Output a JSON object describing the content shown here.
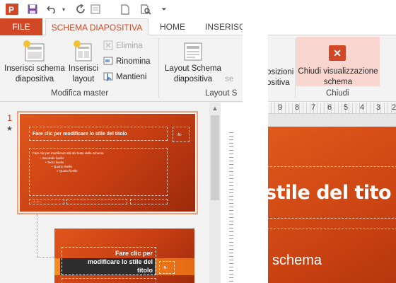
{
  "quick_access": {
    "icons": [
      "powerpoint-logo-icon",
      "save-icon",
      "undo-icon",
      "undo-dropdown-icon",
      "redo-icon",
      "format-painter-icon",
      "new-document-icon",
      "print-preview-icon",
      "customize-dropdown-icon"
    ]
  },
  "tabs": {
    "file": "FILE",
    "slide_master": "SCHEMA DIAPOSITIVA",
    "home": "HOME",
    "insert": "INSERISC"
  },
  "ribbon": {
    "insert_slide_master": "Inserisci schema diapositiva",
    "insert_slide_master_l1": "Inserisci schema",
    "insert_slide_master_l2": "diapositiva",
    "insert_layout_l1": "Inserisci",
    "insert_layout_l2": "layout",
    "delete": "Elimina",
    "rename": "Rinomina",
    "preserve": "Mantieni",
    "group_edit_master": "Modifica master",
    "master_layout_l1": "Layout Schema",
    "master_layout_l2": "diapositiva",
    "group_master_layout": "Layout S",
    "cut_text": "se",
    "right_partial_l1": "osizioni",
    "right_partial_l2": "ositiva",
    "close_view_l1": "Chiudi visualizzazione",
    "close_view_l2": "schema",
    "group_close": "Chiudi"
  },
  "slides_panel": {
    "slide_number": "1",
    "star": "★",
    "thumb1": {
      "title": "Fare clic per modificare lo stile del titolo",
      "num_placeholder": "‹N›",
      "body_lines": [
        "Fare clic per modificare stili del testo dello schema",
        "– Secondo livello",
        "• Terzo livello",
        "– Quarto livello",
        "» Quinto livello"
      ],
      "footer_date": "—/—/—"
    },
    "thumb2": {
      "title_l1": "Fare clic per",
      "title_l2": "modificare lo stile del",
      "title_l3": "titolo",
      "num_placeholder": "‹N›"
    }
  },
  "ruler": {
    "marks": [
      "9",
      "8",
      "7",
      "6",
      "5",
      "4",
      "3",
      "2"
    ]
  },
  "canvas": {
    "title_fragment": "stile del tito",
    "body_fragment": "schema"
  },
  "colors": {
    "accent": "#d24726",
    "slide_orange": "#d9501a"
  }
}
